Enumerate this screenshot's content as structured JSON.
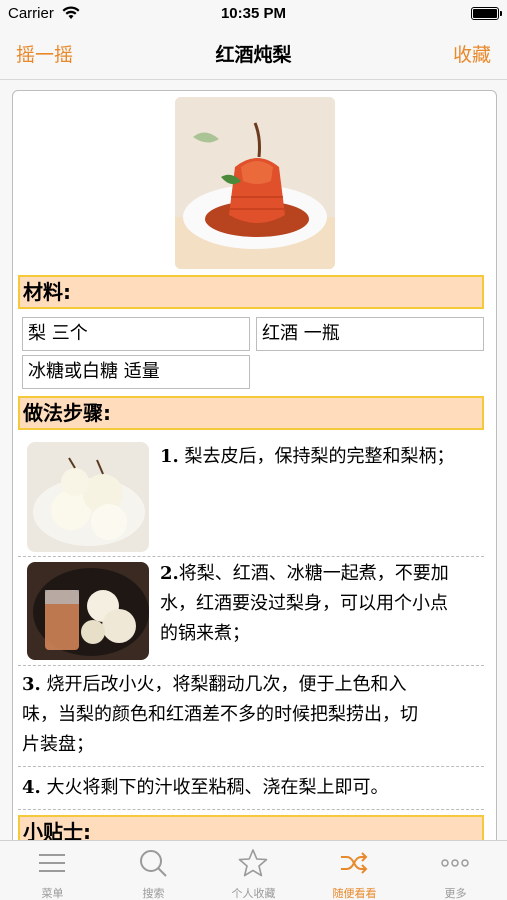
{
  "status_bar": {
    "carrier": "Carrier",
    "time": "10:35 PM"
  },
  "nav": {
    "left_button": "摇一摇",
    "title": "红酒炖梨",
    "right_button": "收藏"
  },
  "recipe": {
    "ingredients_header": "材料:",
    "ingredients": [
      "梨 三个",
      "红酒 一瓶",
      "冰糖或白糖 适量"
    ],
    "steps_header": "做法步骤:",
    "steps": [
      {
        "num": "1.",
        "text": "梨去皮后，保持梨的完整和梨柄；"
      },
      {
        "num": "2.",
        "text_line1": "将梨、红酒、冰糖一起煮，不要加",
        "text_line2": "水，红酒要没过梨身，可以用个小点",
        "text_line3": "的锅来煮；"
      },
      {
        "num": "3.",
        "text_line1": "烧开后改小火，将梨翻动几次，便于上色和入",
        "text_line2": "味，当梨的颜色和红酒差不多的时候把梨捞出，切",
        "text_line3": "片装盘；"
      },
      {
        "num": "4.",
        "text": "大火将剩下的汁收至粘稠、浇在梨上即可。"
      }
    ],
    "tips_header": "小贴士:"
  },
  "tab_bar": {
    "tabs": [
      {
        "label": "菜单",
        "icon": "menu-icon"
      },
      {
        "label": "搜索",
        "icon": "search-icon"
      },
      {
        "label": "个人收藏",
        "icon": "star-icon"
      },
      {
        "label": "随便看看",
        "icon": "shuffle-icon"
      },
      {
        "label": "更多",
        "icon": "more-icon"
      }
    ],
    "active_tab": "随便看看"
  },
  "colors": {
    "accent": "#e8892b",
    "section_bg": "#ffdcbc",
    "section_border": "#f5c93a"
  }
}
